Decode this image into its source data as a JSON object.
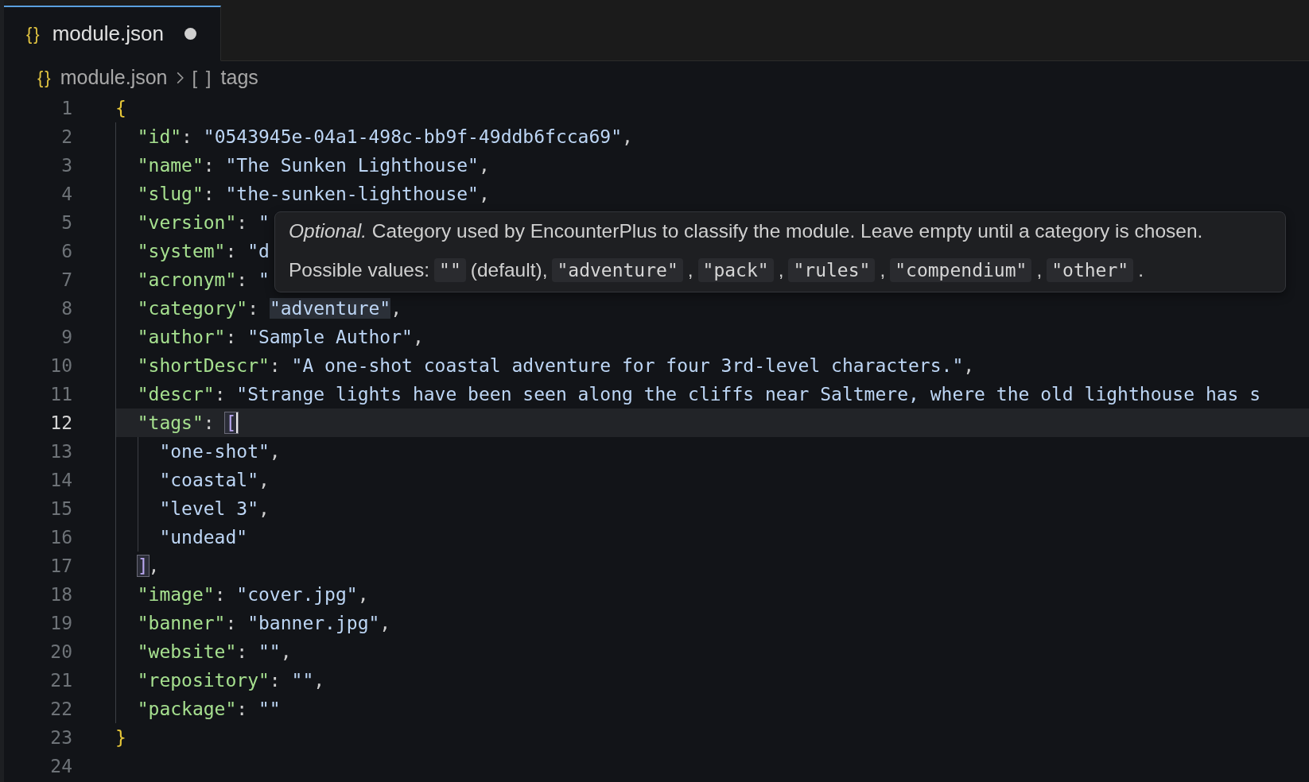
{
  "tabs": [
    {
      "icon": "{}",
      "label": "module.json",
      "modified": true,
      "selected": true
    }
  ],
  "breadcrumb": [
    {
      "icon": "{}",
      "label": "module.json"
    },
    {
      "icon": "[ ]",
      "label": "tags"
    }
  ],
  "lines": [
    {
      "number": "1",
      "current": false,
      "tokens": [
        {
          "kind": "brace",
          "text": "{"
        }
      ],
      "children": [
        {
          "number": "2",
          "current": false,
          "tokens": [
            {
              "kind": "key",
              "text": "\"id\""
            },
            {
              "kind": "punct",
              "text": ": "
            },
            {
              "kind": "string",
              "text": "\"0543945e-04a1-498c-bb9f-49ddb6fcca69\""
            },
            {
              "kind": "punct",
              "text": ","
            }
          ]
        },
        {
          "number": "3",
          "current": false,
          "tokens": [
            {
              "kind": "key",
              "text": "\"name\""
            },
            {
              "kind": "punct",
              "text": ": "
            },
            {
              "kind": "string",
              "text": "\"The Sunken Lighthouse\""
            },
            {
              "kind": "punct",
              "text": ","
            }
          ]
        },
        {
          "number": "4",
          "current": false,
          "tokens": [
            {
              "kind": "key",
              "text": "\"slug\""
            },
            {
              "kind": "punct",
              "text": ": "
            },
            {
              "kind": "string",
              "text": "\"the-sunken-lighthouse\""
            },
            {
              "kind": "punct",
              "text": ","
            }
          ]
        },
        {
          "number": "5",
          "current": false,
          "tokens": [
            {
              "kind": "key",
              "text": "\"version\""
            },
            {
              "kind": "punct",
              "text": ": "
            },
            {
              "kind": "string",
              "text": "\""
            }
          ]
        },
        {
          "number": "6",
          "current": false,
          "tokens": [
            {
              "kind": "key",
              "text": "\"system\""
            },
            {
              "kind": "punct",
              "text": ": "
            },
            {
              "kind": "string",
              "text": "\"d"
            }
          ]
        },
        {
          "number": "7",
          "current": false,
          "tokens": [
            {
              "kind": "key",
              "text": "\"acronym\""
            },
            {
              "kind": "punct",
              "text": ": "
            },
            {
              "kind": "string",
              "text": "\""
            }
          ]
        },
        {
          "number": "8",
          "current": false,
          "tokens": [
            {
              "kind": "key",
              "text": "\"category\""
            },
            {
              "kind": "punct",
              "text": ": "
            },
            {
              "kind": "string",
              "text": "\"adventure\"",
              "highlighted": true
            },
            {
              "kind": "punct",
              "text": ","
            }
          ]
        },
        {
          "number": "9",
          "current": false,
          "tokens": [
            {
              "kind": "key",
              "text": "\"author\""
            },
            {
              "kind": "punct",
              "text": ": "
            },
            {
              "kind": "string",
              "text": "\"Sample Author\""
            },
            {
              "kind": "punct",
              "text": ","
            }
          ]
        },
        {
          "number": "10",
          "current": false,
          "tokens": [
            {
              "kind": "key",
              "text": "\"shortDescr\""
            },
            {
              "kind": "punct",
              "text": ": "
            },
            {
              "kind": "string",
              "text": "\"A one-shot coastal adventure for four 3rd-level characters.\""
            },
            {
              "kind": "punct",
              "text": ","
            }
          ]
        },
        {
          "number": "11",
          "current": false,
          "tokens": [
            {
              "kind": "key",
              "text": "\"descr\""
            },
            {
              "kind": "punct",
              "text": ": "
            },
            {
              "kind": "string",
              "text": "\"Strange lights have been seen along the cliffs near Saltmere, where the old lighthouse has s"
            }
          ]
        },
        {
          "number": "12",
          "current": true,
          "tokens": [
            {
              "kind": "key",
              "text": "\"tags\""
            },
            {
              "kind": "punct",
              "text": ": "
            },
            {
              "kind": "bracket",
              "text": "[",
              "matched": true,
              "cursor": true
            }
          ],
          "children": [
            {
              "number": "13",
              "current": false,
              "tokens": [
                {
                  "kind": "string",
                  "text": "\"one-shot\""
                },
                {
                  "kind": "punct",
                  "text": ","
                }
              ]
            },
            {
              "number": "14",
              "current": false,
              "tokens": [
                {
                  "kind": "string",
                  "text": "\"coastal\""
                },
                {
                  "kind": "punct",
                  "text": ","
                }
              ]
            },
            {
              "number": "15",
              "current": false,
              "tokens": [
                {
                  "kind": "string",
                  "text": "\"level 3\""
                },
                {
                  "kind": "punct",
                  "text": ","
                }
              ]
            },
            {
              "number": "16",
              "current": false,
              "tokens": [
                {
                  "kind": "string",
                  "text": "\"undead\""
                }
              ]
            }
          ]
        },
        {
          "number": "17",
          "current": false,
          "tokens": [
            {
              "kind": "bracket",
              "text": "]",
              "matched": true
            },
            {
              "kind": "punct",
              "text": ","
            }
          ]
        },
        {
          "number": "18",
          "current": false,
          "tokens": [
            {
              "kind": "key",
              "text": "\"image\""
            },
            {
              "kind": "punct",
              "text": ": "
            },
            {
              "kind": "string",
              "text": "\"cover.jpg\""
            },
            {
              "kind": "punct",
              "text": ","
            }
          ]
        },
        {
          "number": "19",
          "current": false,
          "tokens": [
            {
              "kind": "key",
              "text": "\"banner\""
            },
            {
              "kind": "punct",
              "text": ": "
            },
            {
              "kind": "string",
              "text": "\"banner.jpg\""
            },
            {
              "kind": "punct",
              "text": ","
            }
          ]
        },
        {
          "number": "20",
          "current": false,
          "tokens": [
            {
              "kind": "key",
              "text": "\"website\""
            },
            {
              "kind": "punct",
              "text": ": "
            },
            {
              "kind": "string",
              "text": "\"\""
            },
            {
              "kind": "punct",
              "text": ","
            }
          ]
        },
        {
          "number": "21",
          "current": false,
          "tokens": [
            {
              "kind": "key",
              "text": "\"repository\""
            },
            {
              "kind": "punct",
              "text": ": "
            },
            {
              "kind": "string",
              "text": "\"\""
            },
            {
              "kind": "punct",
              "text": ","
            }
          ]
        },
        {
          "number": "22",
          "current": false,
          "tokens": [
            {
              "kind": "key",
              "text": "\"package\""
            },
            {
              "kind": "punct",
              "text": ": "
            },
            {
              "kind": "string",
              "text": "\"\""
            }
          ]
        }
      ]
    },
    {
      "number": "23",
      "current": false,
      "tokens": [
        {
          "kind": "brace",
          "text": "}"
        }
      ]
    },
    {
      "number": "24",
      "current": false
    }
  ],
  "tooltip": {
    "description": "*Optional.* Category used by EncounterPlus to classify the module. Leave empty until a category is chosen.",
    "values": [
      {
        "kind": "text",
        "text": "Possible values:"
      },
      {
        "kind": "code",
        "text": "\"\""
      },
      {
        "kind": "text",
        "text": "(default),"
      },
      {
        "kind": "code",
        "text": "\"adventure\""
      },
      {
        "kind": "text",
        "text": ","
      },
      {
        "kind": "code",
        "text": "\"pack\""
      },
      {
        "kind": "text",
        "text": ","
      },
      {
        "kind": "code",
        "text": "\"rules\""
      },
      {
        "kind": "text",
        "text": ","
      },
      {
        "kind": "code",
        "text": "\"compendium\""
      },
      {
        "kind": "text",
        "text": ","
      },
      {
        "kind": "code",
        "text": "\"other\""
      },
      {
        "kind": "text",
        "text": "."
      }
    ]
  }
}
